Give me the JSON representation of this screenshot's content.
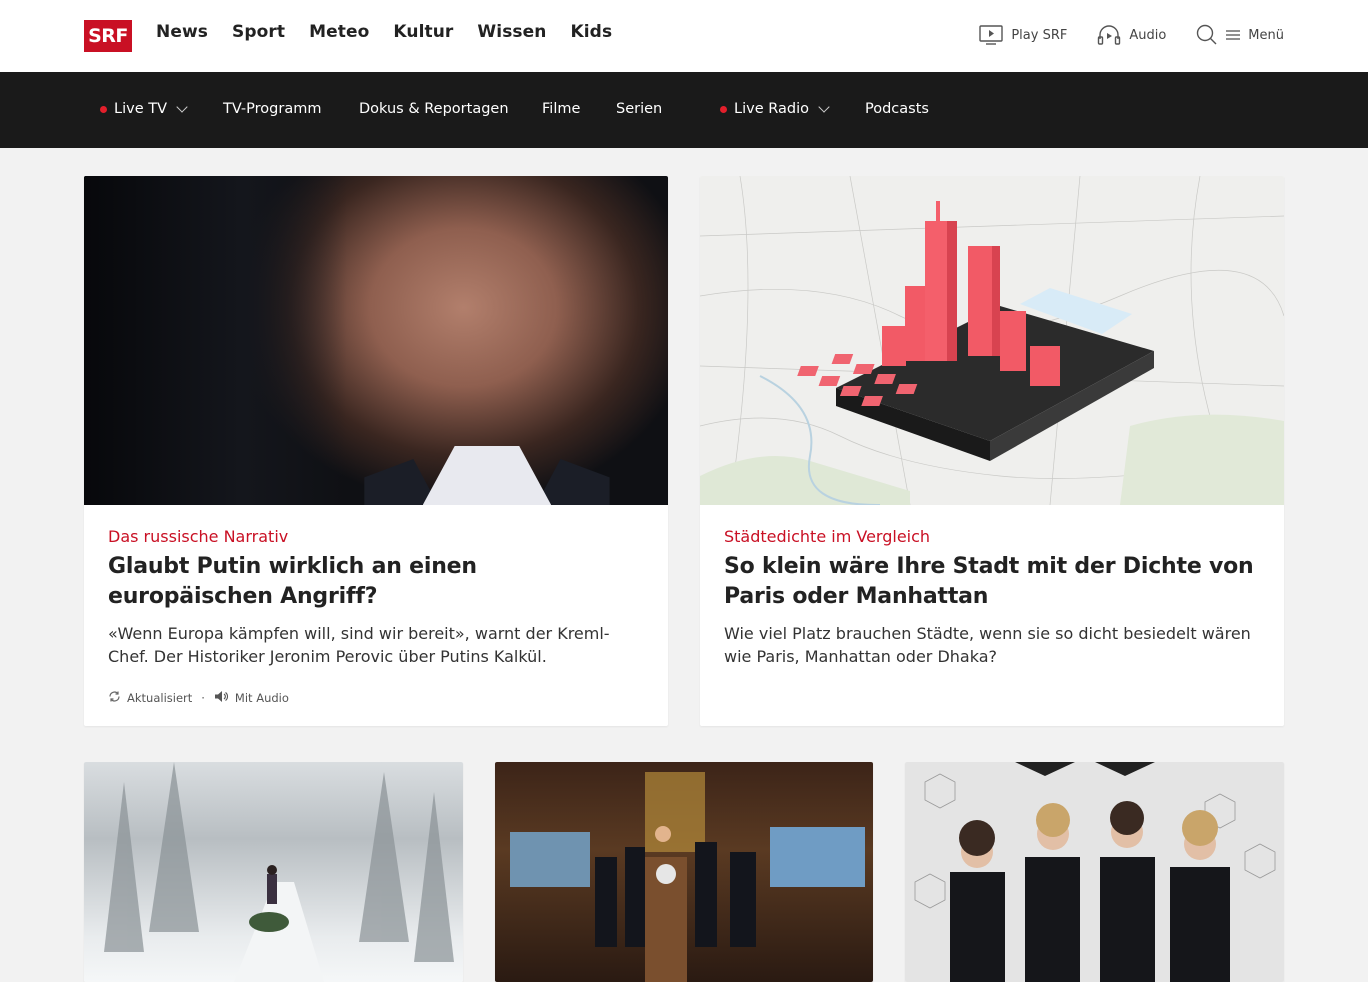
{
  "logo": "SRF",
  "main_nav": [
    "News",
    "Sport",
    "Meteo",
    "Kultur",
    "Wissen",
    "Kids"
  ],
  "utils": {
    "play": "Play SRF",
    "audio": "Audio",
    "menu": "Menü"
  },
  "sub_nav": {
    "live_tv": "Live TV",
    "tv_programm": "TV-Programm",
    "dokus": "Dokus & Reportagen",
    "filme": "Filme",
    "serien": "Serien",
    "live_radio": "Live Radio",
    "podcasts": "Podcasts"
  },
  "colors": {
    "brand": "#c91024",
    "live_dot": "#e31f2b",
    "subnav_bg": "#1a1a1a",
    "page_bg": "#f2f2f2"
  },
  "articles": [
    {
      "kicker": "Das russische Narrativ",
      "title": "Glaubt Putin wirklich an einen europäischen Angriff?",
      "lead": "«Wenn Europa kämpfen will, sind wir bereit», warnt der Kreml-Chef. Der Historiker Jeronim Perovic über Putins Kalkül.",
      "meta_updated": "Aktualisiert",
      "meta_audio": "Mit Audio"
    },
    {
      "kicker": "Städtedichte im Vergleich",
      "title": "So klein wäre Ihre Stadt mit der Dichte von Paris oder Manhattan",
      "lead": "Wie viel Platz brauchen Städte, wenn sie so dicht besiedelt wären wie Paris, Manhattan oder Dhaka?"
    }
  ]
}
